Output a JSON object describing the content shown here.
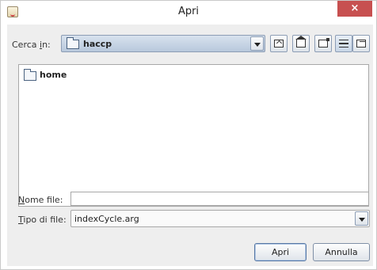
{
  "window": {
    "title": "Apri",
    "close_glyph": "×",
    "app_icon": "java-cup-icon"
  },
  "look_in": {
    "label_pre": "Cerca ",
    "label_mn": "i",
    "label_post": "n:",
    "value": "haccp",
    "icon": "folder-icon"
  },
  "toolbar": {
    "buttons": [
      "up-one-level",
      "home",
      "new-folder",
      "list-view",
      "details-view"
    ],
    "active": "list-view"
  },
  "file_list": {
    "items": [
      {
        "name": "home",
        "icon": "folder-icon"
      }
    ]
  },
  "file_name": {
    "label_mn": "N",
    "label_post": "ome file:",
    "value": ""
  },
  "file_type": {
    "label_mn": "T",
    "label_post": "ipo di file:",
    "value": "indexCycle.arg"
  },
  "buttons": {
    "open": "Apri",
    "cancel": "Annulla"
  },
  "colors": {
    "close": "#c75050",
    "combo_selected": "#b8c8dc"
  }
}
